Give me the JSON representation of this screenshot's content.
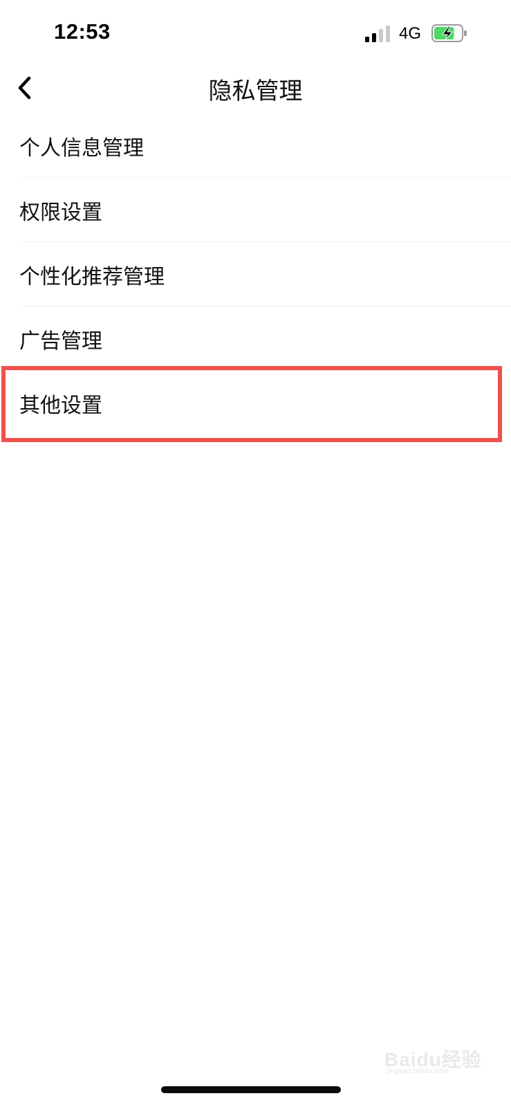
{
  "status_bar": {
    "time": "12:53",
    "network": "4G",
    "signal_icon": "cellular-signal-icon",
    "battery_icon": "battery-charging-icon",
    "battery_level": 0.75,
    "battery_color": "#4cd964"
  },
  "nav": {
    "title": "隐私管理",
    "back_icon": "chevron-left-icon"
  },
  "menu": {
    "items": [
      {
        "label": "个人信息管理"
      },
      {
        "label": "权限设置"
      },
      {
        "label": "个性化推荐管理"
      },
      {
        "label": "广告管理"
      },
      {
        "label": "其他设置"
      }
    ]
  },
  "annotation": {
    "highlight_color": "#f1504a",
    "highlighted_item": "其他设置"
  },
  "watermark": {
    "text": "Baidu经验",
    "sub": "jingyan.baidu.com"
  }
}
